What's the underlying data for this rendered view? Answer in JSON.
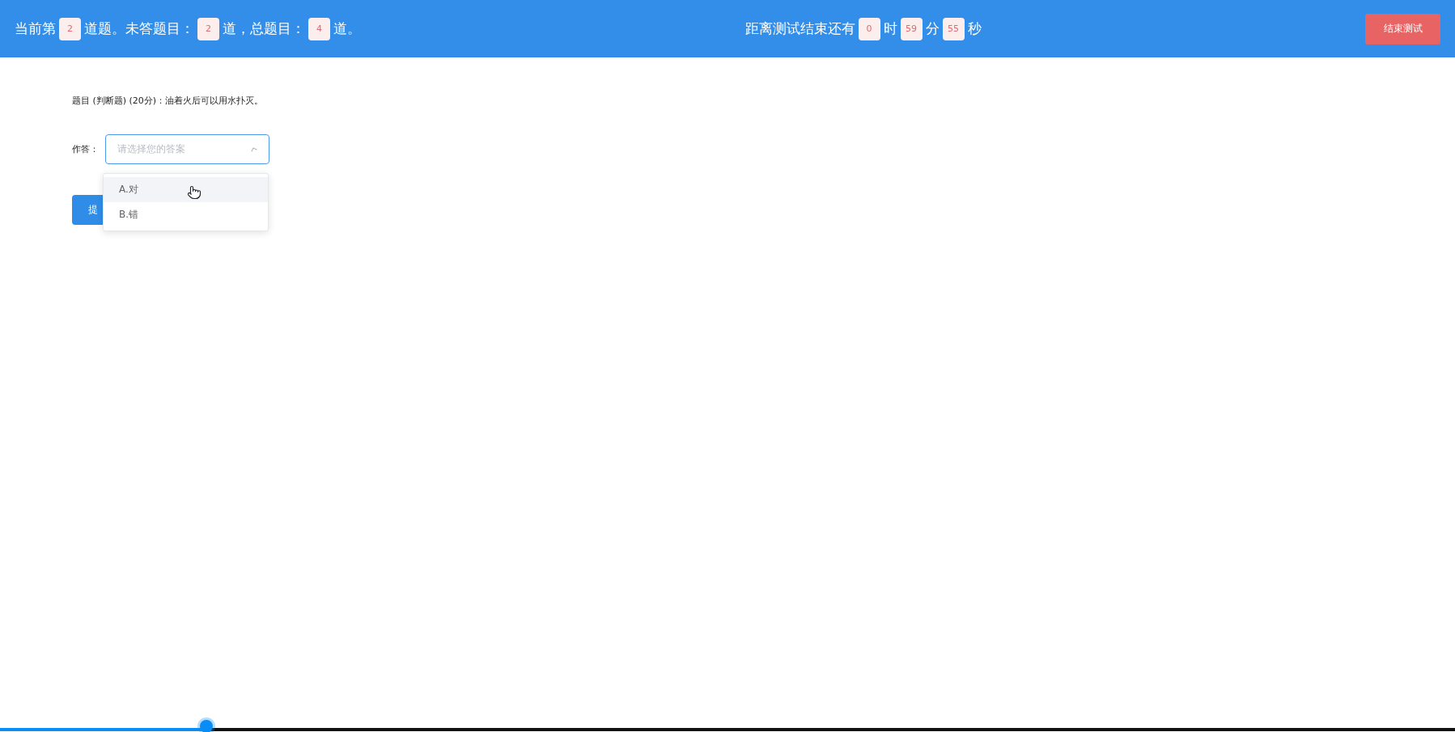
{
  "header": {
    "progress": [
      {
        "kind": "text",
        "text": "当前第"
      },
      {
        "kind": "badge",
        "text": "2"
      },
      {
        "kind": "text",
        "text": "道题。未答题目："
      },
      {
        "kind": "badge",
        "text": "2"
      },
      {
        "kind": "text",
        "text": "道，总题目："
      },
      {
        "kind": "badge",
        "text": "4"
      },
      {
        "kind": "text",
        "text": "道。"
      }
    ],
    "timer": [
      {
        "kind": "text",
        "text": "距离测试结束还有"
      },
      {
        "kind": "badge",
        "text": "0"
      },
      {
        "kind": "text",
        "text": "时"
      },
      {
        "kind": "badge",
        "text": "59"
      },
      {
        "kind": "text",
        "text": "分"
      },
      {
        "kind": "badge",
        "text": "55"
      },
      {
        "kind": "text",
        "text": "秒"
      }
    ],
    "end_button": "结束测试"
  },
  "question": "题目 (判断题) (20分)：油着火后可以用水扑灭。",
  "answer": {
    "label": "作答：",
    "placeholder": "请选择您的答案",
    "expanded": true,
    "options": [
      {
        "label": "A.对",
        "hovered": true
      },
      {
        "label": "B.错",
        "hovered": false
      }
    ]
  },
  "submit_button": "提",
  "video_progress": {
    "level": 0.142
  }
}
